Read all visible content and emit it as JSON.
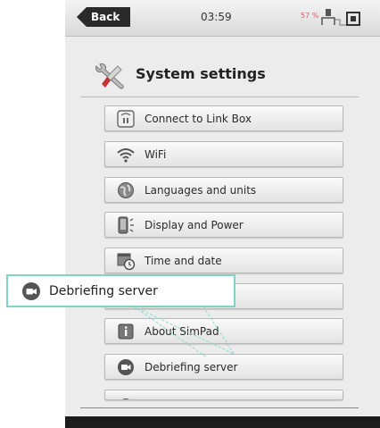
{
  "status_bar": {
    "back_label": "Back",
    "time": "03:59",
    "battery": "57 %"
  },
  "page": {
    "title": "System settings",
    "title_icon": "wrench-screwdriver-icon"
  },
  "menu_items": [
    {
      "label": "Connect to Link Box",
      "icon": "link-box-icon"
    },
    {
      "label": "WiFi",
      "icon": "wifi-icon"
    },
    {
      "label": "Languages and units",
      "icon": "globe-icon"
    },
    {
      "label": "Display and Power",
      "icon": "display-power-icon"
    },
    {
      "label": "Time and date",
      "icon": "calendar-clock-icon"
    },
    {
      "label": "",
      "icon": ""
    },
    {
      "label": "About SimPad",
      "icon": "info-icon"
    },
    {
      "label": "Debriefing server",
      "icon": "video-camera-icon"
    },
    {
      "label": "",
      "icon": "partially-hidden-icon"
    }
  ],
  "callout": {
    "label": "Debriefing server",
    "icon": "video-camera-icon",
    "accent_color": "#7fd4c6"
  }
}
